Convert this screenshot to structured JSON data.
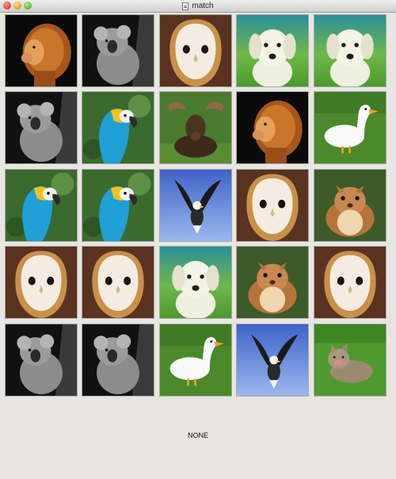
{
  "window": {
    "title": "match"
  },
  "status": {
    "text": "NONE"
  },
  "cards": [
    [
      "lion",
      "koala",
      "owl",
      "puppy",
      "puppy"
    ],
    [
      "koala",
      "macaw",
      "moose",
      "lion",
      "duck"
    ],
    [
      "macaw",
      "macaw",
      "eagle",
      "owl",
      "chipmunk"
    ],
    [
      "owl",
      "owl",
      "puppy",
      "chipmunk",
      "owl"
    ],
    [
      "koala",
      "koala",
      "duck",
      "eagle",
      "kitten"
    ]
  ],
  "colors": {
    "window_bg": "#e8e6e2",
    "lion_bg": "#0a0a0a",
    "owl_bg": "#5a3220",
    "puppy_bg": "#2f9a8f",
    "duck_bg": "#4b8a2a",
    "eagle_bg": "#5b7fd6",
    "chipmunk_bg": "#3d5a2a"
  }
}
